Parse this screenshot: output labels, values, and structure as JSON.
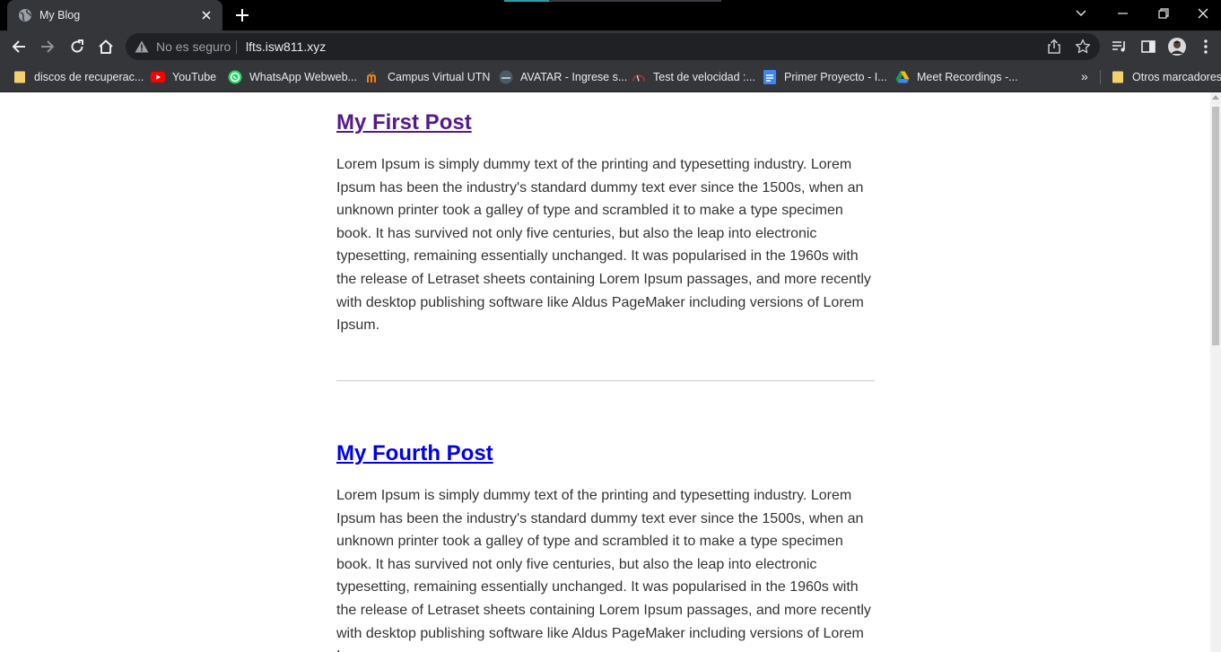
{
  "browser": {
    "tab_title": "My Blog",
    "security_text": "No es seguro",
    "url": "lfts.isw811.xyz"
  },
  "bookmarks": [
    {
      "label": "discos de recuperac...",
      "icon": "folder-icon"
    },
    {
      "label": "YouTube",
      "icon": "youtube-icon"
    },
    {
      "label": "WhatsApp Webweb...",
      "icon": "whatsapp-icon"
    },
    {
      "label": "Campus Virtual UTN",
      "icon": "moodle-icon"
    },
    {
      "label": "AVATAR - Ingrese s...",
      "icon": "avatar-site-icon"
    },
    {
      "label": "Test de velocidad :...",
      "icon": "speedometer-icon"
    },
    {
      "label": "Primer Proyecto - I...",
      "icon": "google-docs-icon"
    },
    {
      "label": "Meet Recordings -...",
      "icon": "google-drive-icon"
    }
  ],
  "bookmarks_overflow": "»",
  "other_bookmarks": "Otros marcadores",
  "posts": [
    {
      "title": "My First Post",
      "body": "Lorem Ipsum is simply dummy text of the printing and typesetting industry. Lorem Ipsum has been the industry's standard dummy text ever since the 1500s, when an unknown printer took a galley of type and scrambled it to make a type specimen book. It has survived not only five centuries, but also the leap into electronic typesetting, remaining essentially unchanged. It was popularised in the 1960s with the release of Letraset sheets containing Lorem Ipsum passages, and more recently with desktop publishing software like Aldus PageMaker including versions of Lorem Ipsum."
    },
    {
      "title": "My Fourth Post",
      "body": "Lorem Ipsum is simply dummy text of the printing and typesetting industry. Lorem Ipsum has been the industry's standard dummy text ever since the 1500s, when an unknown printer took a galley of type and scrambled it to make a type specimen book. It has survived not only five centuries, but also the leap into electronic typesetting, remaining essentially unchanged. It was popularised in the 1960s with the release of Letraset sheets containing Lorem Ipsum passages, and more recently with desktop publishing software like Aldus PageMaker including versions of Lorem Ipsum."
    }
  ],
  "colors": {
    "visited_link": "#551a8b",
    "link": "#0000ee",
    "body_text": "#333333"
  }
}
